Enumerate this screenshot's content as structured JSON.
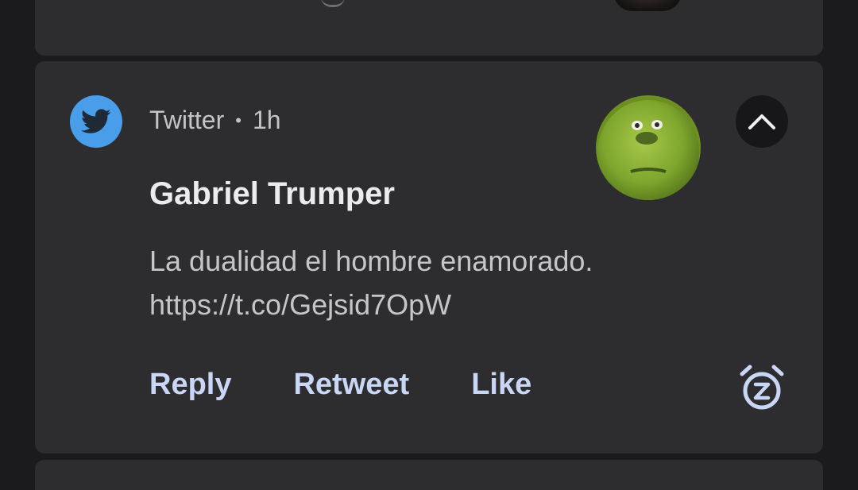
{
  "notification": {
    "app_name": "Twitter",
    "separator": "•",
    "time": "1h",
    "title": "Gabriel Trumper",
    "message_line1": "La dualidad el hombre enamorado.",
    "message_line2": "https://t.co/Gejsid7OpW",
    "app_icon": "twitter-bird-icon",
    "app_icon_color": "#4a9de9",
    "actions": {
      "reply": "Reply",
      "retweet": "Retweet",
      "like": "Like"
    },
    "action_color": "#c9d6f5"
  },
  "theme": {
    "background": "#1b1b1d",
    "card": "#2d2d30"
  }
}
